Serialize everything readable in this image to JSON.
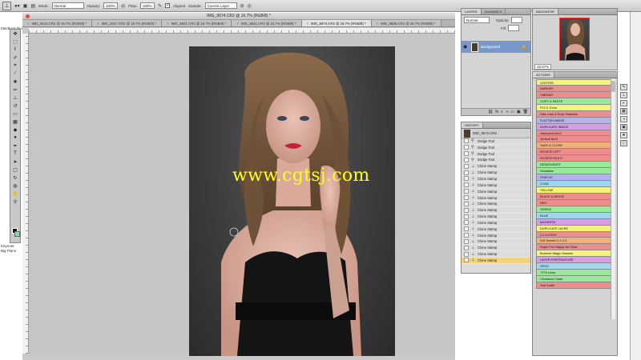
{
  "options_bar": {
    "mode_label": "Mode:",
    "mode_value": "Normal",
    "opacity_label": "Opacity:",
    "opacity_value": "100%",
    "flow_label": "Flow:",
    "flow_value": "100%",
    "aligned_label": "Aligned",
    "sample_label": "Sample:",
    "sample_value": "Current Layer"
  },
  "left_strip": [
    "MacBook Pro",
    "Keynote",
    "Big Plans"
  ],
  "document": {
    "window_title": "IMG_9674.CR2 @ 16.7% (RGB/8) *",
    "tabs": [
      {
        "label": "IMG_9216.CR2 @ 16.7% (RGB/8) *",
        "active": false
      },
      {
        "label": "IMG_9227.CR2 @ 16.7% (RGB/8) *",
        "active": false
      },
      {
        "label": "IMG_9631.CR2 @ 16.7% (RGB/8) *",
        "active": false
      },
      {
        "label": "IMG_9641.CR2 @ 16.7% (RGB/8) *",
        "active": false
      },
      {
        "label": "IMG_9674.CR2 @ 16.7% (RGB/8) *",
        "active": true
      },
      {
        "label": "IMG_9685.CR2 @ 16.7% (RGB/8) *",
        "active": false
      }
    ],
    "watermark": "www.cgtsj.com"
  },
  "layers_panel": {
    "tabs": [
      "LAYERS",
      "CHANNELS"
    ],
    "blend_mode": "Normal",
    "opacity_label": "Opacity:",
    "fill_label": "Fill:",
    "layer_name": "Background"
  },
  "history_panel": {
    "title": "HISTORY",
    "snapshot": "IMG_9674.CR2",
    "items": [
      {
        "label": "Dodge Tool",
        "selected": false
      },
      {
        "label": "Dodge Tool",
        "selected": false
      },
      {
        "label": "Dodge Tool",
        "selected": false
      },
      {
        "label": "Dodge Tool",
        "selected": false
      },
      {
        "label": "Clone Stamp",
        "selected": false
      },
      {
        "label": "Clone Stamp",
        "selected": false
      },
      {
        "label": "Clone Stamp",
        "selected": false
      },
      {
        "label": "Clone Stamp",
        "selected": false
      },
      {
        "label": "Clone Stamp",
        "selected": false
      },
      {
        "label": "Clone Stamp",
        "selected": false
      },
      {
        "label": "Clone Stamp",
        "selected": false
      },
      {
        "label": "Clone Stamp",
        "selected": false
      },
      {
        "label": "Clone Stamp",
        "selected": false
      },
      {
        "label": "Clone Stamp",
        "selected": false
      },
      {
        "label": "Clone Stamp",
        "selected": false
      },
      {
        "label": "Clone Stamp",
        "selected": false
      },
      {
        "label": "Clone Stamp",
        "selected": false
      },
      {
        "label": "Clone Stamp",
        "selected": false
      },
      {
        "label": "Clone Stamp",
        "selected": false
      },
      {
        "label": "Clone Stamp",
        "selected": true
      }
    ]
  },
  "navigator_panel": {
    "title": "NAVIGATOR",
    "zoom": "16.67%"
  },
  "actions_panel": {
    "title": "ACTIONS",
    "items": [
      {
        "label": "LIGHTER",
        "color": "#f5f37a"
      },
      {
        "label": "DARKER",
        "color": "#ee8d8d"
      },
      {
        "label": "VIBRANT",
        "color": "#ee8d8d"
      },
      {
        "label": "COPY & PASTE",
        "color": "#9ae89a"
      },
      {
        "label": "P.O.S. Echo",
        "color": "#f5f37a"
      },
      {
        "label": "Disk Loss & Drop Shadows",
        "color": "#ee8d8d"
      },
      {
        "label": "FLATTEN IMAGE",
        "color": "#b6b2ee"
      },
      {
        "label": "DUPLICATE IMAGE",
        "color": "#d79ee8"
      },
      {
        "label": "Horizontal 8x12",
        "color": "#ee8d8d"
      },
      {
        "label": "Vertical 8x12",
        "color": "#ee8d8d"
      },
      {
        "label": "SAVE & CLOSE",
        "color": "#f0b07c"
      },
      {
        "label": "ROTATE LEFT",
        "color": "#ee8d8d"
      },
      {
        "label": "ROTATE RIGHT",
        "color": "#ee8d8d"
      },
      {
        "label": "DESATURATE",
        "color": "#9ae89a"
      },
      {
        "label": "Gradation",
        "color": "#9ae89a"
      },
      {
        "label": "STAR 40",
        "color": "#b6b2ee"
      },
      {
        "label": "CYAN",
        "color": "#9fd8ee"
      },
      {
        "label": "YELLOW",
        "color": "#f5f37a"
      },
      {
        "label": "BLACK & WHITE",
        "color": "#ee8d8d"
      },
      {
        "label": "RED",
        "color": "#ee8d8d"
      },
      {
        "label": "GREEN",
        "color": "#9ae89a"
      },
      {
        "label": "BLUE",
        "color": "#9fd8ee"
      },
      {
        "label": "MAGENTA",
        "color": "#d79ee8"
      },
      {
        "label": "DUPLICATE LAYER",
        "color": "#f5f37a"
      },
      {
        "label": "2 x 3 CROP",
        "color": "#ee8d8d"
      },
      {
        "label": "2x3 Sender 2.1 3.3",
        "color": "#f0b07c"
      },
      {
        "label": "Super Fun Happy No Glow",
        "color": "#ee8d8d"
      },
      {
        "label": "Bookmrt Magic Glasses",
        "color": "#f5f37a"
      },
      {
        "label": "LAYER PORTRAITURE",
        "color": "#d79ee8"
      },
      {
        "label": "SPOC",
        "color": "#9fd8ee"
      },
      {
        "label": "T.P.S Livey",
        "color": "#9ae89a"
      },
      {
        "label": "Cinnamon Toast",
        "color": "#9ae89a"
      },
      {
        "label": "Sad Sodhi",
        "color": "#ee8d8d"
      }
    ]
  }
}
